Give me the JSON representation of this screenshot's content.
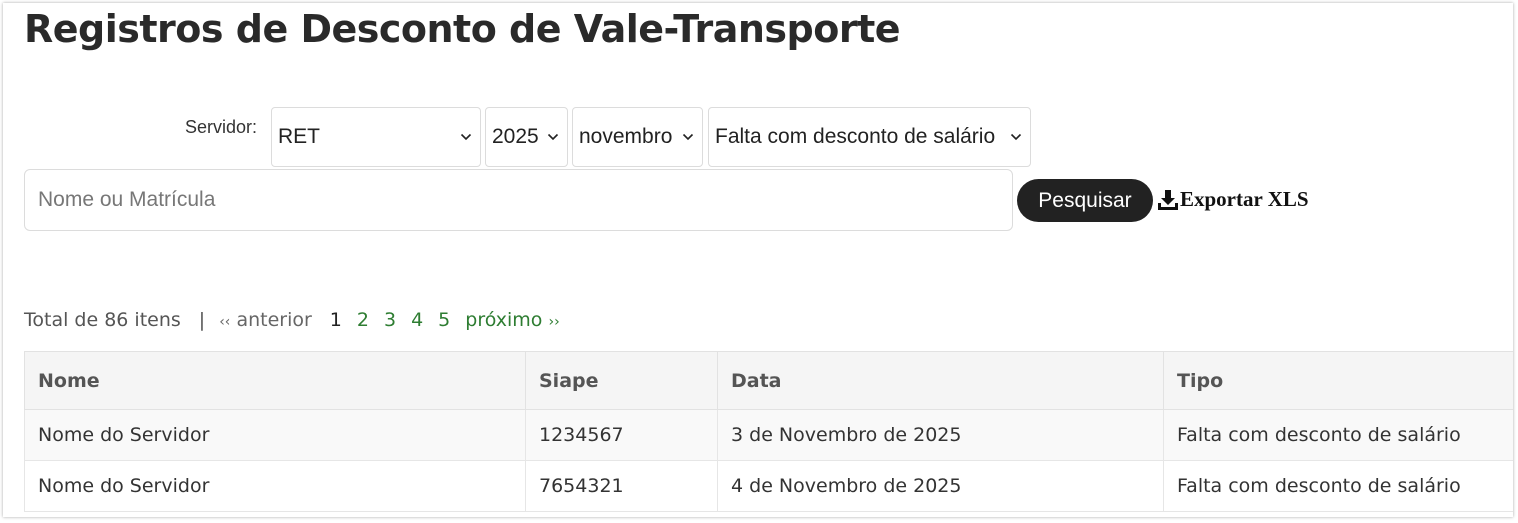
{
  "page": {
    "title": "Registros de Desconto de Vale-Transporte"
  },
  "filters": {
    "servidor_label": "Servidor:",
    "unit_select": "RET",
    "year_select": "2025",
    "month_select": "novembro",
    "type_select": "Falta com desconto de salário"
  },
  "search": {
    "placeholder": "Nome ou Matrícula",
    "value": "",
    "button_label": "Pesquisar",
    "export_label": "Exportar XLS"
  },
  "pagination": {
    "total": "Total de 86 itens",
    "separator": "|",
    "prev_arrow": "‹‹",
    "prev_label": "anterior",
    "pages": [
      "1",
      "2",
      "3",
      "4",
      "5"
    ],
    "current_page": "1",
    "next_label": "próximo",
    "next_arrow": "››"
  },
  "table": {
    "columns": [
      "Nome",
      "Siape",
      "Data",
      "Tipo"
    ],
    "rows": [
      [
        "Nome do Servidor",
        "1234567",
        "3 de Novembro de 2025",
        "Falta com desconto de salário"
      ],
      [
        "Nome do Servidor",
        "7654321",
        "4 de Novembro de 2025",
        "Falta com desconto de salário"
      ]
    ]
  },
  "colors": {
    "link_green": "#2e7d32",
    "button_dark": "#222222",
    "header_bg": "#f5f5f5"
  },
  "icons": {
    "select_chevron": "chevron-down-icon",
    "export": "download-icon"
  }
}
